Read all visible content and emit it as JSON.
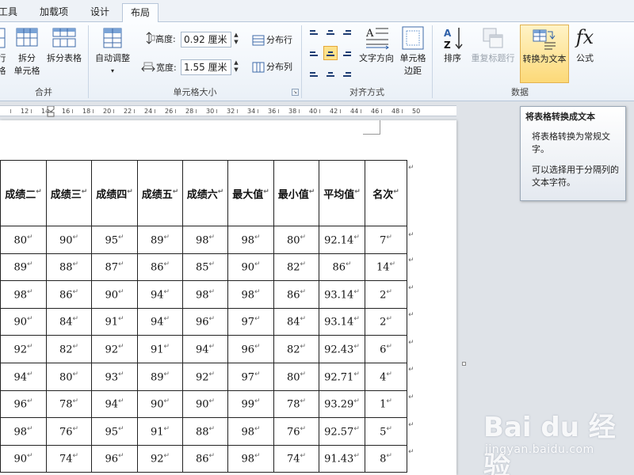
{
  "tabs": {
    "tools": "工具",
    "addins": "加载项",
    "design": "设计",
    "layout": "布局"
  },
  "ribbon": {
    "merge_group": {
      "label": "合并",
      "partial_top": "行",
      "partial_bottom": "格",
      "split_cells_line1": "拆分",
      "split_cells_line2": "单元格",
      "split_table": "拆分表格"
    },
    "cell_size_group": {
      "label": "单元格大小",
      "autofit": "自动调整",
      "height_label": "高度:",
      "height_value": "0.92 厘米",
      "width_label": "宽度:",
      "width_value": "1.55 厘米",
      "distribute_rows": "分布行",
      "distribute_cols": "分布列"
    },
    "alignment_group": {
      "label": "对齐方式",
      "text_direction": "文字方向",
      "cell_margins_line1": "单元格",
      "cell_margins_line2": "边距"
    },
    "data_group": {
      "label": "数据",
      "sort": "排序",
      "repeat_header": "重复标题行",
      "convert_to_text": "转换为文本",
      "formula": "公式"
    }
  },
  "tooltip": {
    "title": "将表格转换成文本",
    "body": "将表格转换为常规文字。",
    "body2": "可以选择用于分隔列的文本字符。"
  },
  "ruler": {
    "ticks": [
      "12",
      "14",
      "16",
      "18",
      "20",
      "22",
      "24",
      "26",
      "28",
      "30",
      "32",
      "34",
      "36",
      "38",
      "40",
      "42",
      "44",
      "46",
      "48",
      "50"
    ]
  },
  "table": {
    "headers": [
      "成绩二",
      "成绩三",
      "成绩四",
      "成绩五",
      "成绩六",
      "最大值",
      "最小值",
      "平均值",
      "名次"
    ],
    "rows": [
      [
        "80",
        "90",
        "95",
        "89",
        "98",
        "98",
        "80",
        "92.14",
        "7"
      ],
      [
        "89",
        "88",
        "87",
        "86",
        "85",
        "90",
        "82",
        "86",
        "14"
      ],
      [
        "98",
        "86",
        "90",
        "94",
        "98",
        "98",
        "86",
        "93.14",
        "2"
      ],
      [
        "90",
        "84",
        "91",
        "94",
        "96",
        "97",
        "84",
        "93.14",
        "2"
      ],
      [
        "92",
        "82",
        "92",
        "91",
        "94",
        "96",
        "82",
        "92.43",
        "6"
      ],
      [
        "94",
        "80",
        "93",
        "89",
        "92",
        "97",
        "80",
        "92.71",
        "4"
      ],
      [
        "96",
        "78",
        "94",
        "90",
        "90",
        "99",
        "78",
        "93.29",
        "1"
      ],
      [
        "98",
        "76",
        "95",
        "91",
        "88",
        "98",
        "76",
        "92.57",
        "5"
      ],
      [
        "90",
        "74",
        "96",
        "92",
        "86",
        "98",
        "74",
        "91.43",
        "8"
      ]
    ]
  },
  "watermark": {
    "logo": "Bai du 经验",
    "url": "jingyan.baidu.com"
  },
  "colors": {
    "ribbon_bg": "#eaf0f7",
    "selected_button": "#fcd978",
    "tab_border": "#b7c6d9"
  }
}
